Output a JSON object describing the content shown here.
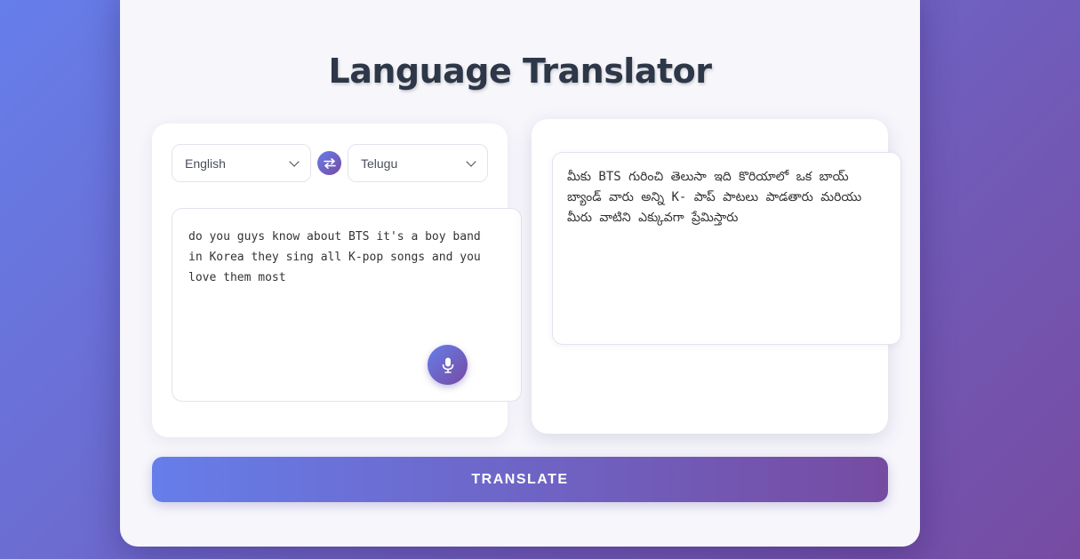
{
  "app": {
    "title": "Language Translator"
  },
  "source": {
    "language": "English",
    "text": "do you guys know about BTS it's a boy band in Korea they sing all K-pop songs and you love them most"
  },
  "target": {
    "language": "Telugu",
    "text": "మీకు BTS గురించి తెలుసా ఇది కొరియాలో ఒక బాయ్ బ్యాండ్ వారు అన్ని K- పాప్ పాటలు పాడతారు మరియు మీరు వాటిని ఎక్కువగా ప్రేమిస్తారు"
  },
  "actions": {
    "translate_label": "TRANSLATE"
  },
  "icons": {
    "swap": "swap-arrows-icon",
    "mic": "microphone-icon",
    "dropdown": "chevron-down-icon"
  },
  "colors": {
    "gradient_start": "#667eea",
    "gradient_end": "#764ba2",
    "title": "#2d3748"
  }
}
